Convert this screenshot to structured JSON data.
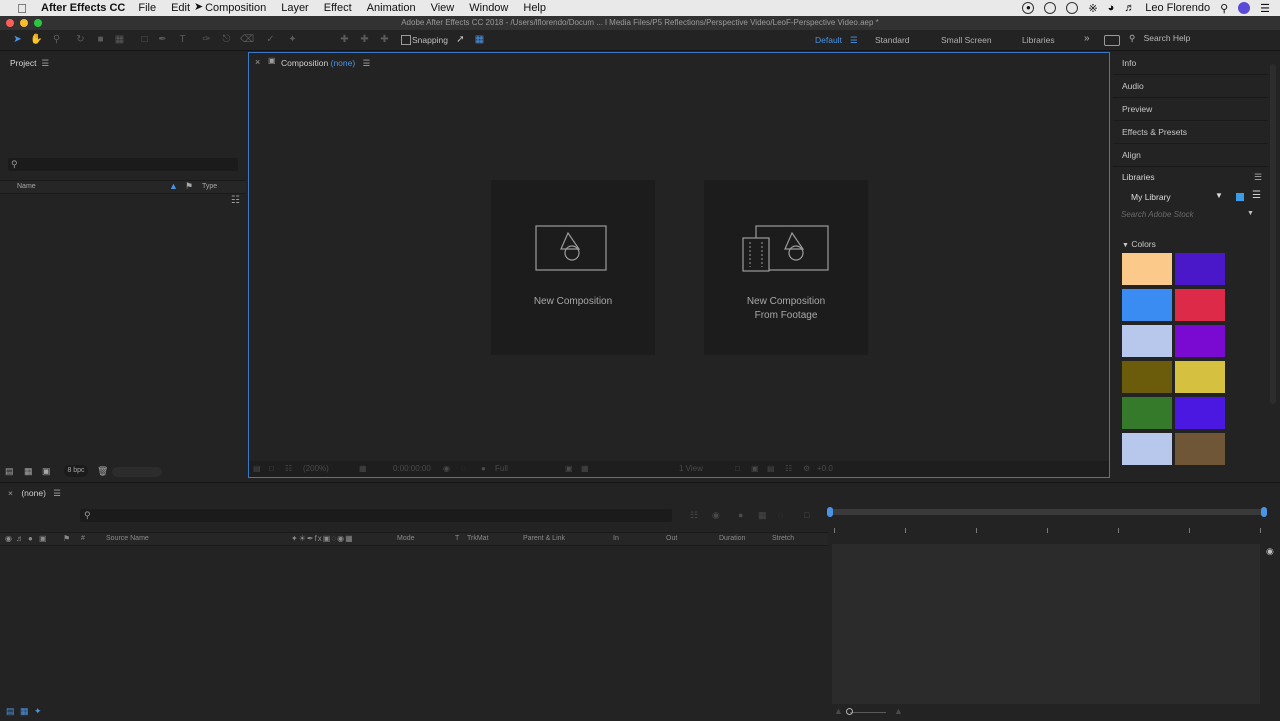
{
  "menubar": {
    "app_name": "After Effects CC",
    "items": [
      "File",
      "Edit",
      "Composition",
      "Layer",
      "Effect",
      "Animation",
      "View",
      "Window",
      "Help"
    ],
    "user": "Leo Florendo"
  },
  "window": {
    "title": "Adobe After Effects CC 2018 - /Users/lflorendo/Docum ... l Media Files/P5 Reflections/Perspective Video/LeoF-Perspective Video.aep *"
  },
  "toolbar": {
    "snapping_label": "Snapping",
    "workspaces": [
      "Default",
      "Standard",
      "Small Screen",
      "Libraries"
    ],
    "search_help_placeholder": "Search Help"
  },
  "project": {
    "title": "Project",
    "col_name": "Name",
    "col_type": "Type",
    "bpc": "8 bpc"
  },
  "composition": {
    "label": "Composition",
    "name": "(none)",
    "cards": [
      {
        "line1": "New Composition",
        "line2": ""
      },
      {
        "line1": "New Composition",
        "line2": "From Footage"
      }
    ],
    "zoom": "(200%)",
    "timecode": "0:00:00:00",
    "resolution": "Full",
    "views": "1 View",
    "exposure": "+0.0"
  },
  "panels": {
    "items": [
      "Info",
      "Audio",
      "Preview",
      "Effects & Presets",
      "Align"
    ],
    "libraries_title": "Libraries",
    "library_name": "My Library",
    "stock_placeholder": "Search Adobe Stock",
    "colors_label": "Colors",
    "swatches": [
      "#fbc98a",
      "#4a18c8",
      "#3a8cf2",
      "#dc2a48",
      "#b8c8ec",
      "#7a0ad2",
      "#6a5c0a",
      "#d6c040",
      "#357a2a",
      "#4a18e0",
      "#b8c8ec",
      "#6e5636"
    ]
  },
  "timeline": {
    "title": "(none)",
    "columns": {
      "hash": "#",
      "source": "Source Name",
      "mode": "Mode",
      "t": "T",
      "trkmat": "TrkMat",
      "parent": "Parent & Link",
      "in": "In",
      "out": "Out",
      "duration": "Duration",
      "stretch": "Stretch"
    }
  }
}
